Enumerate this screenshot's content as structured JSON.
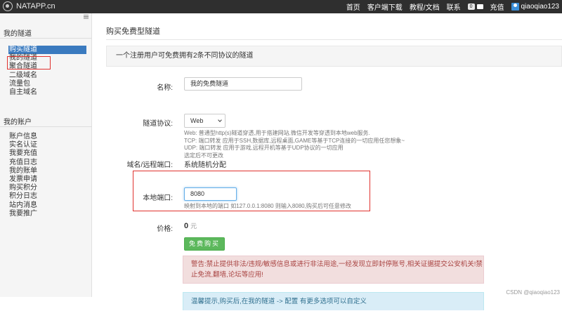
{
  "topbar": {
    "brand": "NATAPP.cn",
    "nav": [
      "首页",
      "客户端下载",
      "教程/文档",
      "联系"
    ],
    "balance": "0",
    "recharge": "充值",
    "username": "qiaoqiao123"
  },
  "sidebar": {
    "section1_title": "我的隧道",
    "tunnel_items": [
      "购买隧道",
      "我的隧道",
      "聚合隧道",
      "二级域名",
      "流量包",
      "自主域名"
    ],
    "section2_title": "我的账户",
    "account_items": [
      "账户信息",
      "实名认证",
      "我要充值",
      "充值日志",
      "我的账单",
      "发票申请",
      "购买积分",
      "积分日志",
      "站内消息",
      "我要推广"
    ]
  },
  "main": {
    "page_title": "购买免费型隧道",
    "info": "一个注册用户可免费拥有2条不同协议的隧道",
    "name_label": "名称:",
    "name_value": "我的免费隧道",
    "protocol_label": "隧道协议:",
    "protocol_value": "Web",
    "protocol_help": [
      "Web: 普通型http(s)隧道穿透,用于搭建网站,微信开发等穿透到本地web服务.",
      "TCP: 端口转发 应用于SSH,数据库,远程桌面,GAME等基于TCP连接的一切应用任您想象~",
      "UDP: 端口转发 应用于游戏,远程开机等基于UDP协议的一切应用",
      "选定后不可更改"
    ],
    "domain_label": "域名/远程端口:",
    "domain_value": "系统随机分配",
    "port_label": "本地端口:",
    "port_value": "8080",
    "port_help": "映射到本地的端口 如127.0.0.1:8080 则输入8080,购买后可任意修改",
    "price_label": "价格:",
    "price_value": "0",
    "price_unit": "元",
    "buy_button": "免费购买",
    "warning": "警告:禁止提供非法/违规/敏感信息或进行非法用途,一经发现立即封停账号,相关证据提交公安机关!禁止免流,翻墙,论坛等应用!",
    "tip": "温馨提示,购买后,在我的隧道 -> 配置 有更多选项可以自定义"
  },
  "watermark": "CSDN @qiaoqiao123"
}
